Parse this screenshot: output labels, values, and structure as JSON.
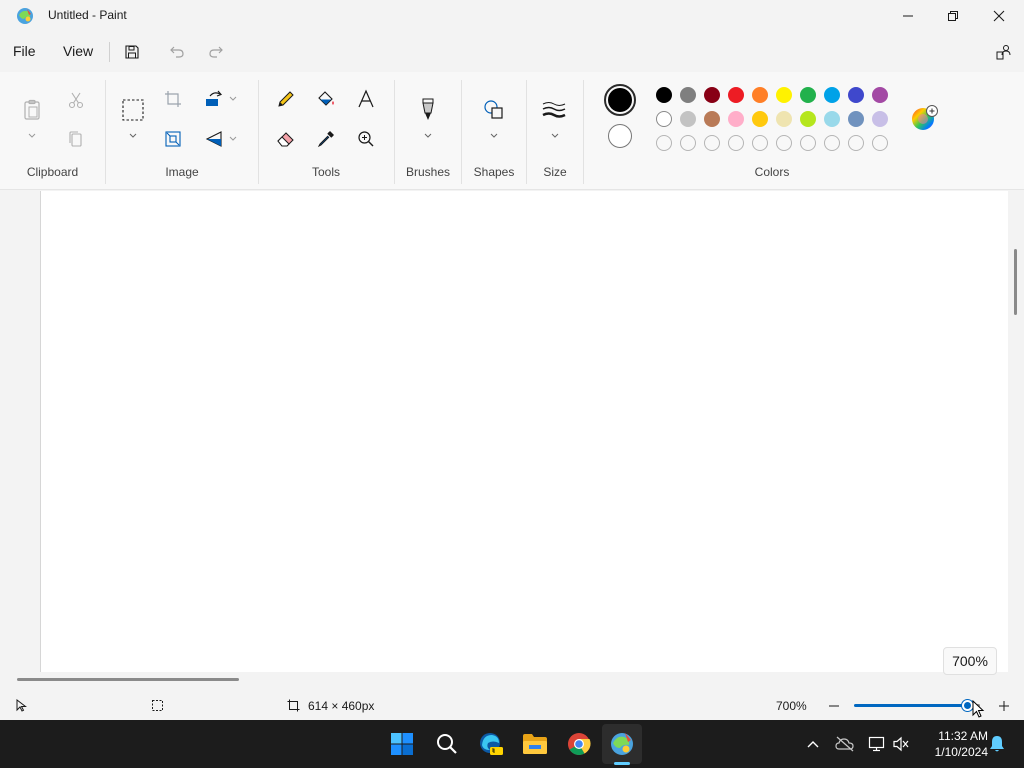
{
  "window": {
    "title": "Untitled - Paint"
  },
  "menu": {
    "file": "File",
    "view": "View"
  },
  "ribbon": {
    "groups": {
      "clipboard": "Clipboard",
      "image": "Image",
      "tools": "Tools",
      "brushes": "Brushes",
      "shapes": "Shapes",
      "size": "Size",
      "colors": "Colors"
    }
  },
  "colors": {
    "primary": "#000000",
    "secondary": "#ffffff",
    "palette_row1": [
      "#000000",
      "#7f7f7f",
      "#880015",
      "#ed1c24",
      "#ff7f27",
      "#fff200",
      "#22b14c",
      "#00a2e8",
      "#3f48cc",
      "#a349a4"
    ],
    "palette_row2": [
      "#ffffff",
      "#c3c3c3",
      "#b97a57",
      "#ffaec9",
      "#ffc90e",
      "#efe4b0",
      "#b5e61d",
      "#99d9ea",
      "#7092be",
      "#c8bfe7"
    ],
    "palette_row3_empty_count": 10,
    "accent": "#0067c0"
  },
  "canvas": {
    "zoom_tooltip": "700%"
  },
  "status": {
    "dimensions": "614 × 460px",
    "zoom": "700%",
    "zoom_slider_fraction": 0.9
  },
  "taskbar": {
    "time": "11:32 AM",
    "date": "1/10/2024"
  }
}
